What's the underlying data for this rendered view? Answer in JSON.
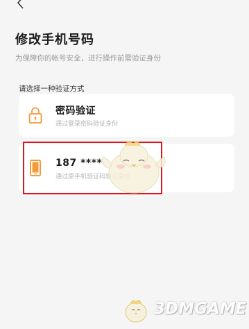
{
  "header": {
    "back_icon": "chevron-left-icon",
    "title": "修改手机号码",
    "subtitle": "为保障你的帐号安全，进行操作前需验证身份"
  },
  "section_label": "请选择一种验证方式",
  "methods": [
    {
      "icon": "lock-icon",
      "label": "密码验证",
      "description": "通过登录密码验证身份"
    },
    {
      "icon": "phone-icon",
      "label": "187 ****",
      "description": "通过原手机验证码验证身份"
    }
  ],
  "colors": {
    "accent": "#f39c3c",
    "highlight_box": "#d7171f",
    "background": "#f5f5f5"
  },
  "watermark": "3DMGAME"
}
